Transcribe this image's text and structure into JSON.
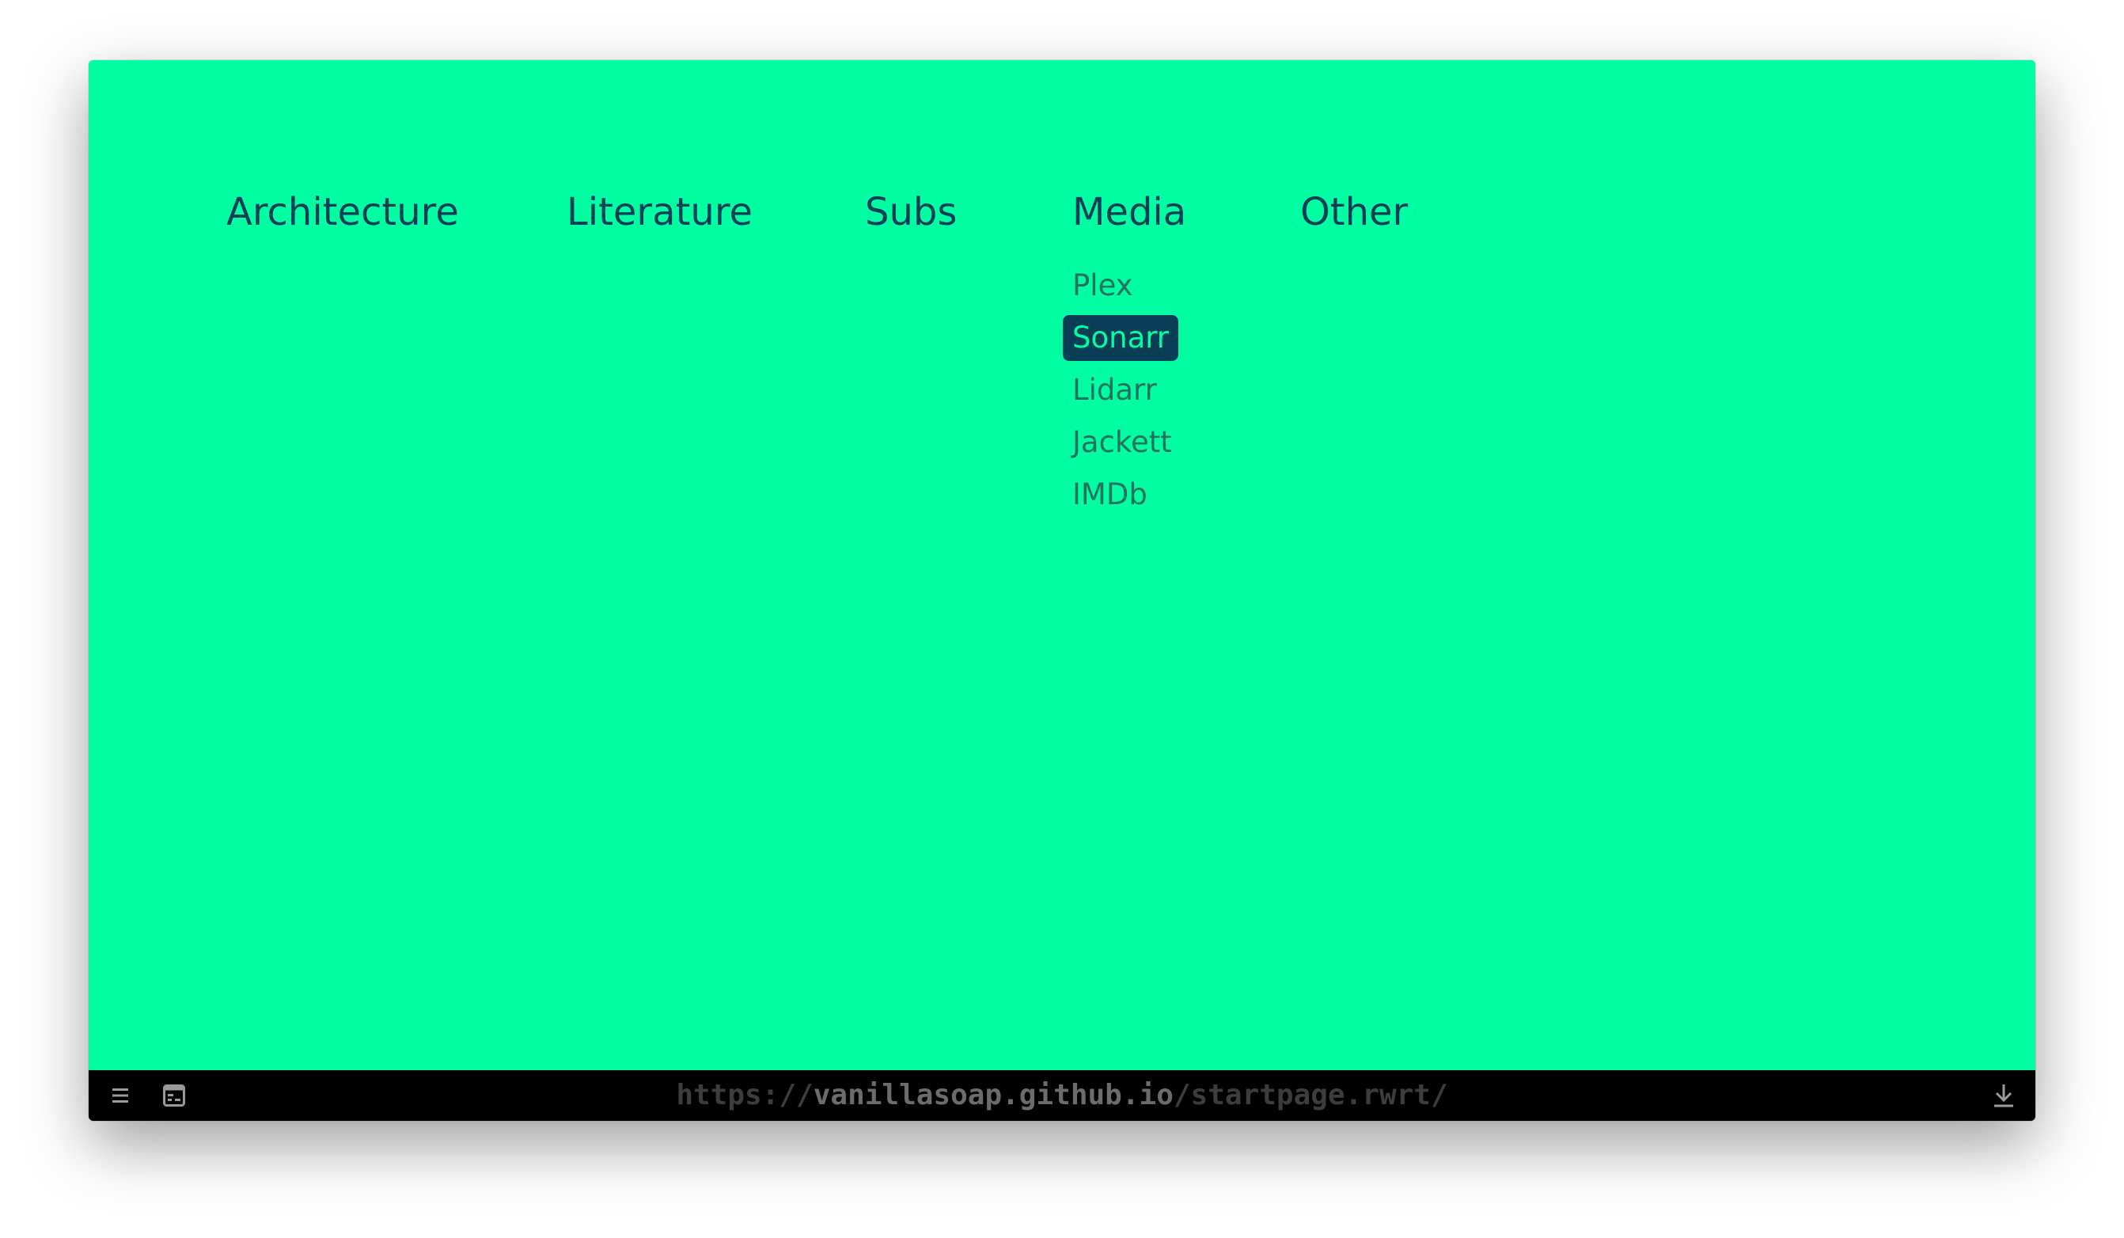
{
  "categories": [
    {
      "label": "Architecture"
    },
    {
      "label": "Literature"
    },
    {
      "label": "Subs"
    },
    {
      "label": "Media"
    },
    {
      "label": "Other"
    }
  ],
  "media_links": [
    {
      "label": "Plex",
      "active": false
    },
    {
      "label": "Sonarr",
      "active": true
    },
    {
      "label": "Lidarr",
      "active": false
    },
    {
      "label": "Jackett",
      "active": false
    },
    {
      "label": "IMDb",
      "active": false
    }
  ],
  "statusbar": {
    "url_scheme": "https://",
    "url_host": "vanillasoap.github.io",
    "url_path": "/startpage.rwrt/",
    "icons": [
      "menu-icon",
      "tab-panel-icon",
      "download-icon"
    ]
  },
  "colors": {
    "background": "#00ffa3",
    "text_dark": "#0b3f57",
    "link_text": "#22725f",
    "statusbar": "#000000"
  }
}
